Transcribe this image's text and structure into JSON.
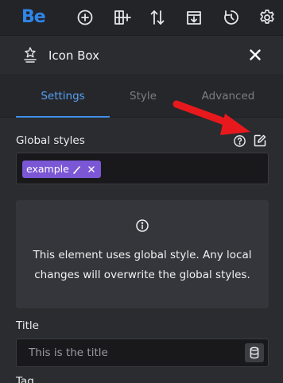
{
  "toolbar": {
    "logo": "Be",
    "icons": [
      "add-icon",
      "structure-add-icon",
      "sort-icon",
      "save-icon",
      "history-icon",
      "settings-gear-icon"
    ]
  },
  "panel": {
    "title": "Icon Box",
    "icon": "icon-box-icon"
  },
  "tabs": [
    {
      "label": "Settings",
      "active": true
    },
    {
      "label": "Style",
      "active": false
    },
    {
      "label": "Advanced",
      "active": false
    }
  ],
  "global_styles": {
    "label": "Global styles",
    "tag": "example"
  },
  "info": {
    "message": "This element uses global style. Any local changes will overwrite the global styles."
  },
  "title_field": {
    "label": "Title",
    "placeholder": "This is the title"
  },
  "next_field": {
    "label": "Tag"
  },
  "colors": {
    "accent": "#3f8ee8",
    "tag": "#7b57d6",
    "annotation": "#e8191c"
  }
}
